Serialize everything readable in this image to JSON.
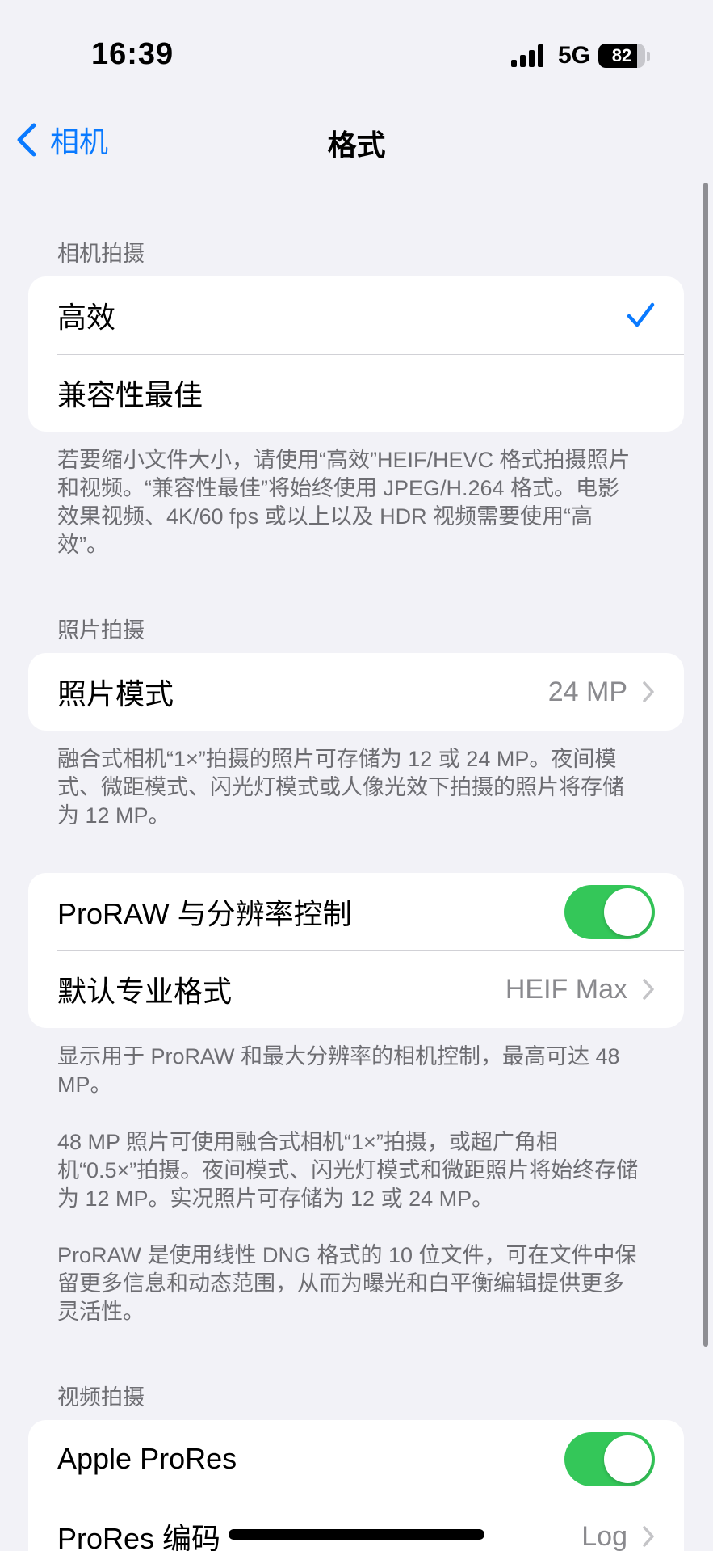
{
  "status_bar": {
    "time": "16:39",
    "network": "5G",
    "battery": "82",
    "battery_level": 0.82
  },
  "nav": {
    "back_label": "相机",
    "title": "格式"
  },
  "camera_capture": {
    "header": "相机拍摄",
    "options": [
      "高效",
      "兼容性最佳"
    ],
    "selected": "高效",
    "footer": "若要缩小文件大小，请使用“高效”HEIF/HEVC 格式拍摄照片和视频。“兼容性最佳”将始终使用 JPEG/H.264 格式。电影效果视频、4K/60 fps 或以上以及 HDR 视频需要使用“高效”。"
  },
  "photo_capture": {
    "header": "照片拍摄",
    "photo_mode_label": "照片模式",
    "photo_mode_value": "24 MP",
    "footer": "融合式相机“1×”拍摄的照片可存储为 12 或 24 MP。夜间模式、微距模式、闪光灯模式或人像光效下拍摄的照片将存储为 12 MP。"
  },
  "proraw": {
    "toggle_label": "ProRAW 与分辨率控制",
    "toggle_on": true,
    "default_format_label": "默认专业格式",
    "default_format_value": "HEIF Max",
    "footer_1": "显示用于 ProRAW 和最大分辨率的相机控制，最高可达 48 MP。",
    "footer_2": "48 MP 照片可使用融合式相机“1×”拍摄，或超广角相机“0.5×”拍摄。夜间模式、闪光灯模式和微距照片将始终存储为 12 MP。实况照片可存储为 12 或 24 MP。",
    "footer_3": "ProRAW 是使用线性 DNG 格式的 10 位文件，可在文件中保留更多信息和动态范围，从而为曝光和白平衡编辑提供更多灵活性。"
  },
  "video_capture": {
    "header": "视频拍摄",
    "prores_label": "Apple ProRes",
    "prores_on": true,
    "encoding_label": "ProRes 编码",
    "encoding_value": "Log"
  },
  "colors": {
    "accent": "#0a7aff",
    "toggle_on": "#34c759",
    "background": "#f2f2f7",
    "secondary_text": "#6d6d72"
  }
}
